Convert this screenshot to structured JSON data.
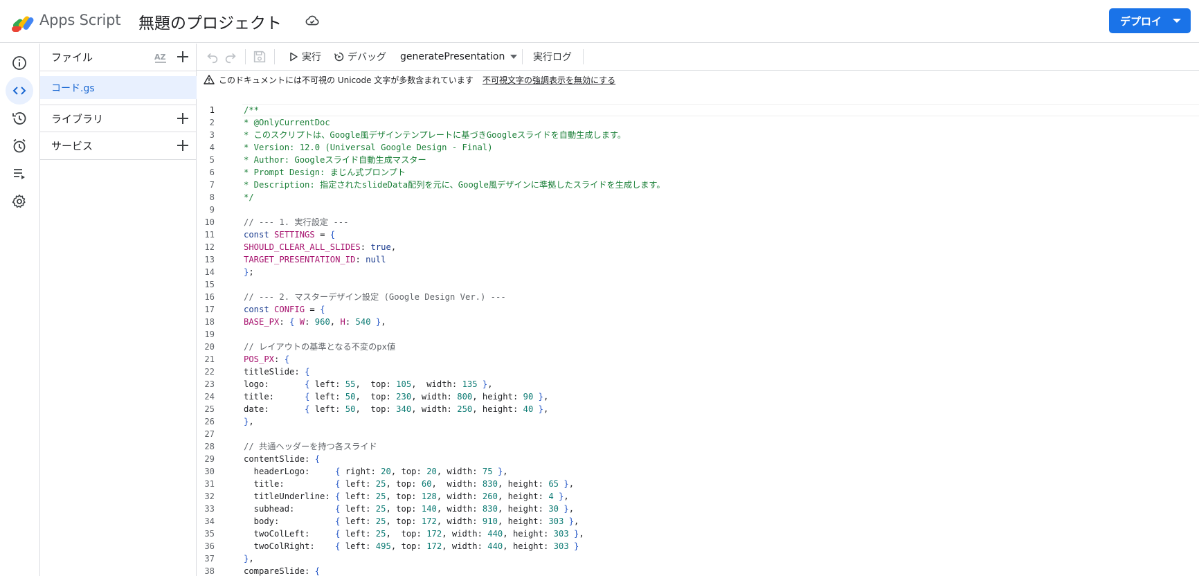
{
  "header": {
    "app_name": "Apps Script",
    "project_title": "無題のプロジェクト",
    "deploy_label": "デプロイ"
  },
  "file_panel": {
    "files_label": "ファイル",
    "sort_icon_text": "AZ",
    "selected_file": "コード.gs",
    "libraries_label": "ライブラリ",
    "services_label": "サービス"
  },
  "toolbar": {
    "run_label": "実行",
    "debug_label": "デバッグ",
    "function_name": "generatePresentation",
    "log_label": "実行ログ"
  },
  "warning": {
    "text": "このドキュメントには不可視の Unicode 文字が多数含まれています",
    "link": "不可視文字の強調表示を無効にする"
  },
  "rail_icons": [
    "info-icon",
    "code-icon",
    "history-icon",
    "alarm-clock-icon",
    "executions-icon",
    "settings-icon"
  ],
  "colors": {
    "accent": "#1a73e8",
    "comment": "#1a7f37",
    "keyword": "#1b3c8f",
    "property": "#a6116d",
    "number": "#0b7a73"
  },
  "code": {
    "current_line": 1,
    "lines": [
      [
        {
          "t": "/**",
          "c": "c"
        }
      ],
      [
        {
          "t": "* @OnlyCurrentDoc",
          "c": "c"
        }
      ],
      [
        {
          "t": "* このスクリプトは、Google風デザインテンプレートに基づきGoogleスライドを自動生成します。",
          "c": "c"
        }
      ],
      [
        {
          "t": "* Version: 12.0 (Universal Google Design - Final)",
          "c": "c"
        }
      ],
      [
        {
          "t": "* Author: Googleスライド自動生成マスター",
          "c": "c"
        }
      ],
      [
        {
          "t": "* Prompt Design: まじん式プロンプト",
          "c": "c"
        }
      ],
      [
        {
          "t": "* Description: 指定されたslideData配列を元に、Google風デザインに準拠したスライドを生成します。",
          "c": "c"
        }
      ],
      [
        {
          "t": "*/",
          "c": "c"
        }
      ],
      [],
      [
        {
          "t": "// --- 1. 実行設定 ---",
          "c": "cm"
        }
      ],
      [
        {
          "t": "const ",
          "c": "k"
        },
        {
          "t": "SETTINGS",
          "c": "v"
        },
        {
          "t": " = ",
          "c": "pr"
        },
        {
          "t": "{",
          "c": "p"
        }
      ],
      [
        {
          "t": "SHOULD_CLEAR_ALL_SLIDES",
          "c": "v"
        },
        {
          "t": ": ",
          "c": "pr"
        },
        {
          "t": "true",
          "c": "k"
        },
        {
          "t": ",",
          "c": "pr"
        }
      ],
      [
        {
          "t": "TARGET_PRESENTATION_ID",
          "c": "v"
        },
        {
          "t": ": ",
          "c": "pr"
        },
        {
          "t": "null",
          "c": "k"
        }
      ],
      [
        {
          "t": "}",
          "c": "p"
        },
        {
          "t": ";",
          "c": "pr"
        }
      ],
      [],
      [
        {
          "t": "// --- 2. マスターデザイン設定 (Google Design Ver.) ---",
          "c": "cm"
        }
      ],
      [
        {
          "t": "const ",
          "c": "k"
        },
        {
          "t": "CONFIG",
          "c": "v"
        },
        {
          "t": " = ",
          "c": "pr"
        },
        {
          "t": "{",
          "c": "p"
        }
      ],
      [
        {
          "t": "BASE_PX",
          "c": "v"
        },
        {
          "t": ": ",
          "c": "pr"
        },
        {
          "t": "{",
          "c": "p"
        },
        {
          "t": " W",
          "c": "v"
        },
        {
          "t": ": ",
          "c": "pr"
        },
        {
          "t": "960",
          "c": "n"
        },
        {
          "t": ", ",
          "c": "pr"
        },
        {
          "t": "H",
          "c": "v"
        },
        {
          "t": ": ",
          "c": "pr"
        },
        {
          "t": "540",
          "c": "n"
        },
        {
          "t": " ",
          "c": "pr"
        },
        {
          "t": "}",
          "c": "p"
        },
        {
          "t": ",",
          "c": "pr"
        }
      ],
      [],
      [
        {
          "t": "// レイアウトの基準となる不変のpx値",
          "c": "cm"
        }
      ],
      [
        {
          "t": "POS_PX",
          "c": "v"
        },
        {
          "t": ": ",
          "c": "pr"
        },
        {
          "t": "{",
          "c": "p"
        }
      ],
      [
        {
          "t": "titleSlide: ",
          "c": "pr"
        },
        {
          "t": "{",
          "c": "p"
        }
      ],
      [
        {
          "t": "logo:       ",
          "c": "pr"
        },
        {
          "t": "{",
          "c": "p"
        },
        {
          "t": " left: ",
          "c": "pr"
        },
        {
          "t": "55",
          "c": "n"
        },
        {
          "t": ",  top: ",
          "c": "pr"
        },
        {
          "t": "105",
          "c": "n"
        },
        {
          "t": ",  width: ",
          "c": "pr"
        },
        {
          "t": "135",
          "c": "n"
        },
        {
          "t": " ",
          "c": "pr"
        },
        {
          "t": "}",
          "c": "p"
        },
        {
          "t": ",",
          "c": "pr"
        }
      ],
      [
        {
          "t": "title:      ",
          "c": "pr"
        },
        {
          "t": "{",
          "c": "p"
        },
        {
          "t": " left: ",
          "c": "pr"
        },
        {
          "t": "50",
          "c": "n"
        },
        {
          "t": ",  top: ",
          "c": "pr"
        },
        {
          "t": "230",
          "c": "n"
        },
        {
          "t": ", width: ",
          "c": "pr"
        },
        {
          "t": "800",
          "c": "n"
        },
        {
          "t": ", height: ",
          "c": "pr"
        },
        {
          "t": "90",
          "c": "n"
        },
        {
          "t": " ",
          "c": "pr"
        },
        {
          "t": "}",
          "c": "p"
        },
        {
          "t": ",",
          "c": "pr"
        }
      ],
      [
        {
          "t": "date:       ",
          "c": "pr"
        },
        {
          "t": "{",
          "c": "p"
        },
        {
          "t": " left: ",
          "c": "pr"
        },
        {
          "t": "50",
          "c": "n"
        },
        {
          "t": ",  top: ",
          "c": "pr"
        },
        {
          "t": "340",
          "c": "n"
        },
        {
          "t": ", width: ",
          "c": "pr"
        },
        {
          "t": "250",
          "c": "n"
        },
        {
          "t": ", height: ",
          "c": "pr"
        },
        {
          "t": "40",
          "c": "n"
        },
        {
          "t": " ",
          "c": "pr"
        },
        {
          "t": "}",
          "c": "p"
        },
        {
          "t": ",",
          "c": "pr"
        }
      ],
      [
        {
          "t": "}",
          "c": "p"
        },
        {
          "t": ",",
          "c": "pr"
        }
      ],
      [],
      [
        {
          "t": "// 共通ヘッダーを持つ各スライド",
          "c": "cm"
        }
      ],
      [
        {
          "t": "contentSlide: ",
          "c": "pr"
        },
        {
          "t": "{",
          "c": "p"
        }
      ],
      [
        {
          "t": "  headerLogo:     ",
          "c": "pr"
        },
        {
          "t": "{",
          "c": "p"
        },
        {
          "t": " right: ",
          "c": "pr"
        },
        {
          "t": "20",
          "c": "n"
        },
        {
          "t": ", top: ",
          "c": "pr"
        },
        {
          "t": "20",
          "c": "n"
        },
        {
          "t": ", width: ",
          "c": "pr"
        },
        {
          "t": "75",
          "c": "n"
        },
        {
          "t": " ",
          "c": "pr"
        },
        {
          "t": "}",
          "c": "p"
        },
        {
          "t": ",",
          "c": "pr"
        }
      ],
      [
        {
          "t": "  title:          ",
          "c": "pr"
        },
        {
          "t": "{",
          "c": "p"
        },
        {
          "t": " left: ",
          "c": "pr"
        },
        {
          "t": "25",
          "c": "n"
        },
        {
          "t": ", top: ",
          "c": "pr"
        },
        {
          "t": "60",
          "c": "n"
        },
        {
          "t": ",  width: ",
          "c": "pr"
        },
        {
          "t": "830",
          "c": "n"
        },
        {
          "t": ", height: ",
          "c": "pr"
        },
        {
          "t": "65",
          "c": "n"
        },
        {
          "t": " ",
          "c": "pr"
        },
        {
          "t": "}",
          "c": "p"
        },
        {
          "t": ",",
          "c": "pr"
        }
      ],
      [
        {
          "t": "  titleUnderline: ",
          "c": "pr"
        },
        {
          "t": "{",
          "c": "p"
        },
        {
          "t": " left: ",
          "c": "pr"
        },
        {
          "t": "25",
          "c": "n"
        },
        {
          "t": ", top: ",
          "c": "pr"
        },
        {
          "t": "128",
          "c": "n"
        },
        {
          "t": ", width: ",
          "c": "pr"
        },
        {
          "t": "260",
          "c": "n"
        },
        {
          "t": ", height: ",
          "c": "pr"
        },
        {
          "t": "4",
          "c": "n"
        },
        {
          "t": " ",
          "c": "pr"
        },
        {
          "t": "}",
          "c": "p"
        },
        {
          "t": ",",
          "c": "pr"
        }
      ],
      [
        {
          "t": "  subhead:        ",
          "c": "pr"
        },
        {
          "t": "{",
          "c": "p"
        },
        {
          "t": " left: ",
          "c": "pr"
        },
        {
          "t": "25",
          "c": "n"
        },
        {
          "t": ", top: ",
          "c": "pr"
        },
        {
          "t": "140",
          "c": "n"
        },
        {
          "t": ", width: ",
          "c": "pr"
        },
        {
          "t": "830",
          "c": "n"
        },
        {
          "t": ", height: ",
          "c": "pr"
        },
        {
          "t": "30",
          "c": "n"
        },
        {
          "t": " ",
          "c": "pr"
        },
        {
          "t": "}",
          "c": "p"
        },
        {
          "t": ",",
          "c": "pr"
        }
      ],
      [
        {
          "t": "  body:           ",
          "c": "pr"
        },
        {
          "t": "{",
          "c": "p"
        },
        {
          "t": " left: ",
          "c": "pr"
        },
        {
          "t": "25",
          "c": "n"
        },
        {
          "t": ", top: ",
          "c": "pr"
        },
        {
          "t": "172",
          "c": "n"
        },
        {
          "t": ", width: ",
          "c": "pr"
        },
        {
          "t": "910",
          "c": "n"
        },
        {
          "t": ", height: ",
          "c": "pr"
        },
        {
          "t": "303",
          "c": "n"
        },
        {
          "t": " ",
          "c": "pr"
        },
        {
          "t": "}",
          "c": "p"
        },
        {
          "t": ",",
          "c": "pr"
        }
      ],
      [
        {
          "t": "  twoColLeft:     ",
          "c": "pr"
        },
        {
          "t": "{",
          "c": "p"
        },
        {
          "t": " left: ",
          "c": "pr"
        },
        {
          "t": "25",
          "c": "n"
        },
        {
          "t": ",  top: ",
          "c": "pr"
        },
        {
          "t": "172",
          "c": "n"
        },
        {
          "t": ", width: ",
          "c": "pr"
        },
        {
          "t": "440",
          "c": "n"
        },
        {
          "t": ", height: ",
          "c": "pr"
        },
        {
          "t": "303",
          "c": "n"
        },
        {
          "t": " ",
          "c": "pr"
        },
        {
          "t": "}",
          "c": "p"
        },
        {
          "t": ",",
          "c": "pr"
        }
      ],
      [
        {
          "t": "  twoColRight:    ",
          "c": "pr"
        },
        {
          "t": "{",
          "c": "p"
        },
        {
          "t": " left: ",
          "c": "pr"
        },
        {
          "t": "495",
          "c": "n"
        },
        {
          "t": ", top: ",
          "c": "pr"
        },
        {
          "t": "172",
          "c": "n"
        },
        {
          "t": ", width: ",
          "c": "pr"
        },
        {
          "t": "440",
          "c": "n"
        },
        {
          "t": ", height: ",
          "c": "pr"
        },
        {
          "t": "303",
          "c": "n"
        },
        {
          "t": " ",
          "c": "pr"
        },
        {
          "t": "}",
          "c": "p"
        }
      ],
      [
        {
          "t": "}",
          "c": "p"
        },
        {
          "t": ",",
          "c": "pr"
        }
      ],
      [
        {
          "t": "compareSlide: ",
          "c": "pr"
        },
        {
          "t": "{",
          "c": "p"
        }
      ]
    ]
  }
}
